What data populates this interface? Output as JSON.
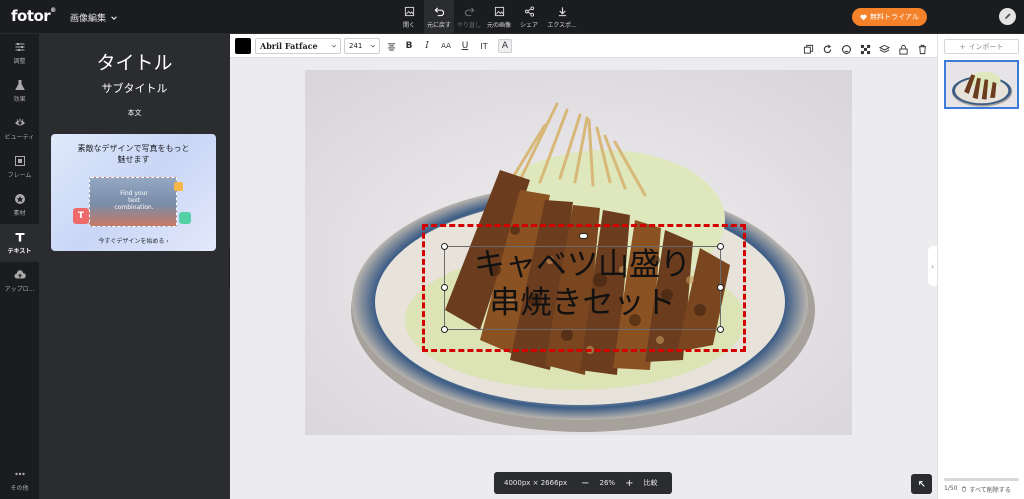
{
  "app": {
    "logo": "fotor",
    "logo_mark": "®",
    "mode_label": "画像編集"
  },
  "toolbar": {
    "open": "開く",
    "undo": "元に戻す",
    "redo": "やり直し",
    "original": "元の画像",
    "share": "シェア",
    "export": "エクスポ..."
  },
  "trial_button": "無料トライアル",
  "rail": {
    "adjust": "調整",
    "effects": "効果",
    "beauty": "ビューティ",
    "frame": "フレーム",
    "elements": "素材",
    "text": "テキスト",
    "upload": "アップロ...",
    "more": "その他"
  },
  "text_panel": {
    "title": "タイトル",
    "subtitle": "サブタイトル",
    "body": "本文",
    "promo_line1": "素敵なデザインで写真をもっと",
    "promo_line2": "魅せます",
    "promo_image_line1": "Find your",
    "promo_image_line2": "text",
    "promo_image_line3": "combination.",
    "promo_link": "今すぐデザインを始める"
  },
  "text_toolbar": {
    "font": "Abril Fatface",
    "size": "241",
    "color": "#000000",
    "bold": "B",
    "italic": "I",
    "transform": "AA",
    "underline": "U",
    "spacing": "IT",
    "effect": "A"
  },
  "canvas": {
    "text_line1": "キャベツ山盛り",
    "text_line2": "串焼きセット"
  },
  "zoom": {
    "dimensions": "4000px × 2666px",
    "minus": "−",
    "percent": "26%",
    "plus": "+",
    "compare": "比較"
  },
  "right_panel": {
    "import": "インポート",
    "page_count": "1/50",
    "delete_all": "すべて削除する"
  },
  "colors": {
    "accent": "#f4822b",
    "selection": "#d30000",
    "thumb_border": "#3c7bd9"
  }
}
